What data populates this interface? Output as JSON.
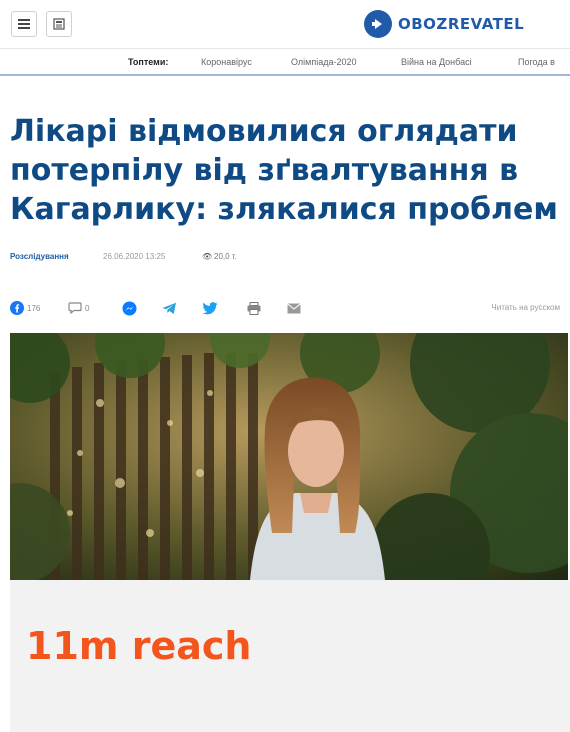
{
  "header": {
    "logo_text": "OBOZREVATEL",
    "menu_icon": "hamburger-menu-icon",
    "newspaper_icon": "newspaper-icon",
    "logo_icon": "arrow-circle-logo-icon"
  },
  "topics": {
    "label": "Топтеми:",
    "items": [
      "Коронавірус",
      "Олімпіада-2020",
      "Війна на Донбасі",
      "Погода в"
    ]
  },
  "article": {
    "title": "Лікарі відмовилися оглядати потерпілу від зґвалтування в Кагарлику: злякалися проблем",
    "category": "Розслідування",
    "date": "26.06.2020 13:25",
    "views": "20,0 т.",
    "views_icon": "eye-icon"
  },
  "share": {
    "facebook_count": "176",
    "comments_count": "0",
    "read_in_russian": "Читать на русском",
    "icons": [
      "facebook-icon",
      "comments-icon",
      "messenger-icon",
      "telegram-icon",
      "twitter-icon",
      "print-icon",
      "email-icon"
    ]
  },
  "banner": {
    "text": "11m reach"
  },
  "colors": {
    "brand_blue": "#1f5ba8",
    "headline_blue": "#0f4a85",
    "banner_orange": "#f2561d"
  }
}
